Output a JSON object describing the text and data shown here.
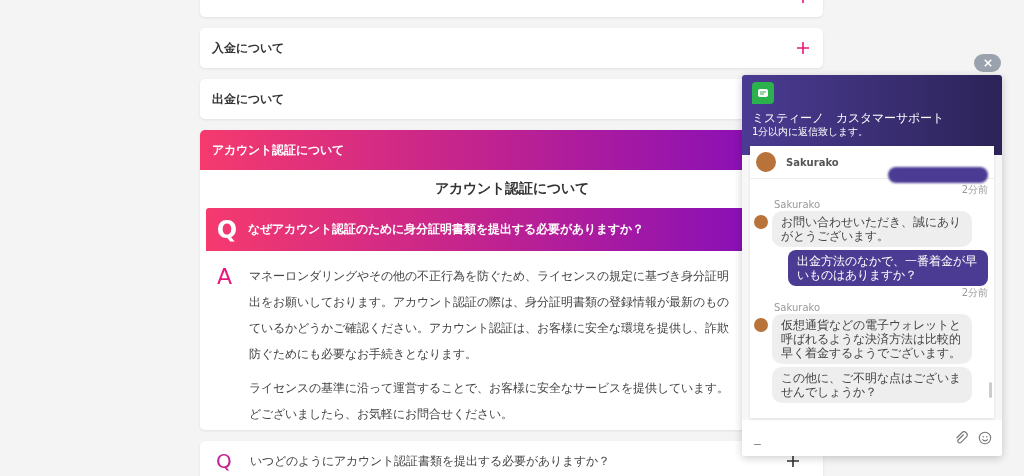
{
  "categories": [
    {
      "expanded": false
    },
    {
      "title": "入金について",
      "expanded": false
    },
    {
      "title": "出金について",
      "expanded": false
    },
    {
      "title": "アカウント認証について",
      "expanded": true,
      "heading": "アカウント認証について",
      "questions": [
        {
          "mark": "Q",
          "question": "なぜアカウント認証のために身分証明書類を提出する必要がありますか？",
          "expanded": true,
          "answer_mark": "A",
          "answer": [
            [
              "マネーロンダリングやその他の不正行為を防ぐため、ライセンスの規定に基づき身分証明",
              "出をお願いしております。アカウント認証の際は、身分証明書類の登録情報が最新のもの",
              "ているかどうかご確認ください。アカウント認証は、お客様に安全な環境を提供し、詐欺",
              "防ぐためにも必要なお手続きとなります。"
            ],
            [
              "ライセンスの基準に沿って運営することで、お客様に安全なサービスを提供しています。",
              "どございましたら、お気軽にお問合せください。"
            ]
          ]
        },
        {
          "mark": "Q",
          "question": "いつどのようにアカウント認証書類を提出する必要がありますか？",
          "expanded": false
        }
      ]
    }
  ],
  "chat": {
    "title": "ミスティーノ　カスタマーサポート",
    "subtitle": "1分以内に返信致します。",
    "agent_name": "Sakurako",
    "messages": [
      {
        "kind": "user",
        "time": "2分前"
      },
      {
        "kind": "agent",
        "sender": "Sakurako",
        "bubbles": [
          "お問い合わせいただき、誠にありがとうございます。"
        ]
      },
      {
        "kind": "user",
        "text": "出金方法のなかで、一番着金が早いものはありますか？",
        "time": "2分前"
      },
      {
        "kind": "agent",
        "sender": "Sakurako",
        "bubbles": [
          "仮想通貨などの電子ウォレットと呼ばれるような決済方法は比較的早く着金するようでございます。",
          "この他に、ご不明な点はございませんでしょうか？"
        ]
      }
    ],
    "input": {
      "placeholder": "_"
    }
  }
}
